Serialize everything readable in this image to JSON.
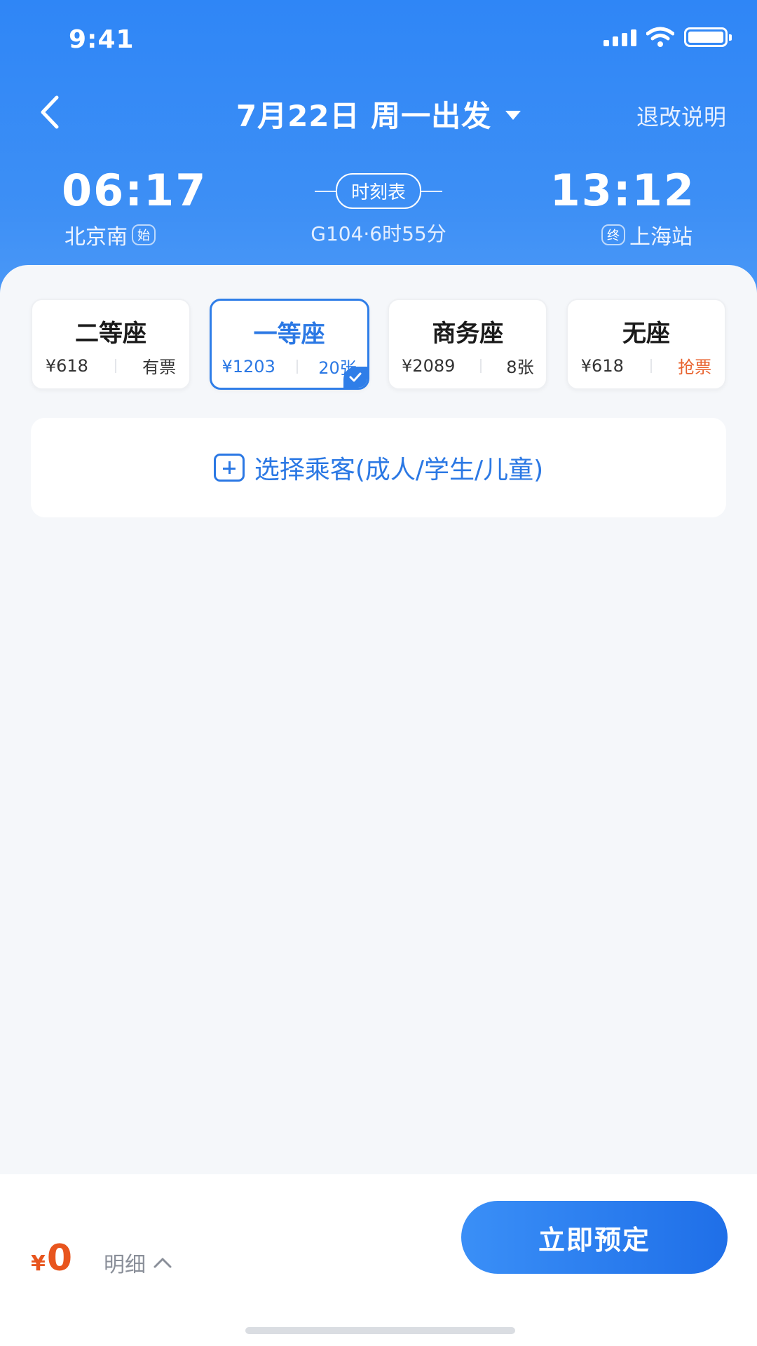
{
  "status_bar": {
    "time": "9:41"
  },
  "nav": {
    "date_title": "7月22日 周一出发",
    "refund_link": "退改说明"
  },
  "trip": {
    "departure_time": "06:17",
    "departure_station": "北京南",
    "departure_tag": "始",
    "arrival_time": "13:12",
    "arrival_station": "上海站",
    "arrival_tag": "终",
    "timetable_label": "时刻表",
    "train_info": "G104·6时55分"
  },
  "seats": [
    {
      "name": "二等座",
      "price": "¥618",
      "availability": "有票",
      "selected": false
    },
    {
      "name": "一等座",
      "price": "¥1203",
      "availability": "20张",
      "selected": true
    },
    {
      "name": "商务座",
      "price": "¥2089",
      "availability": "8张",
      "selected": false
    },
    {
      "name": "无座",
      "price": "¥618",
      "availability": "抢票",
      "selected": false
    }
  ],
  "passenger": {
    "label": "选择乘客(成人/学生/儿童)"
  },
  "footer": {
    "price_symbol": "¥",
    "price_value": "0",
    "detail_label": "明细",
    "book_button": "立即预定"
  },
  "colors": {
    "primary": "#2f7ee8",
    "price": "#e8551e",
    "grab": "#e8622e"
  }
}
